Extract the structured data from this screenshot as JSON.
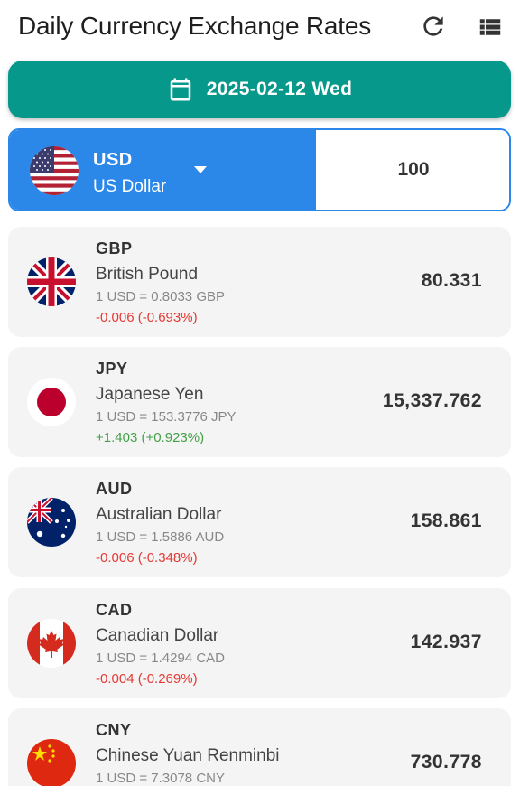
{
  "app_bar": {
    "title": "Daily Currency Exchange Rates",
    "refresh_icon": "refresh-icon",
    "list_icon": "list-view-icon"
  },
  "date_picker": {
    "icon": "calendar-icon",
    "label": "2025-02-12 Wed"
  },
  "base_currency": {
    "flag": "us-flag",
    "code": "USD",
    "name": "US Dollar",
    "amount": "100"
  },
  "colors": {
    "teal": "#06998b",
    "blue": "#2b88e8",
    "negative": "#e53935",
    "positive": "#43a047"
  },
  "rates": [
    {
      "code": "GBP",
      "name": "British Pound",
      "rate": "1 USD = 0.8033 GBP",
      "change": "-0.006 (-0.693%)",
      "direction": "down",
      "value": "80.331",
      "flag": "uk-flag"
    },
    {
      "code": "JPY",
      "name": "Japanese Yen",
      "rate": "1 USD = 153.3776 JPY",
      "change": "+1.403 (+0.923%)",
      "direction": "up",
      "value": "15,337.762",
      "flag": "japan-flag"
    },
    {
      "code": "AUD",
      "name": "Australian Dollar",
      "rate": "1 USD = 1.5886 AUD",
      "change": "-0.006 (-0.348%)",
      "direction": "down",
      "value": "158.861",
      "flag": "australia-flag"
    },
    {
      "code": "CAD",
      "name": "Canadian Dollar",
      "rate": "1 USD = 1.4294 CAD",
      "change": "-0.004 (-0.269%)",
      "direction": "down",
      "value": "142.937",
      "flag": "canada-flag"
    },
    {
      "code": "CNY",
      "name": "Chinese Yuan Renminbi",
      "rate": "1 USD = 7.3078 CNY",
      "change": "",
      "direction": "",
      "value": "730.778",
      "flag": "china-flag"
    }
  ]
}
